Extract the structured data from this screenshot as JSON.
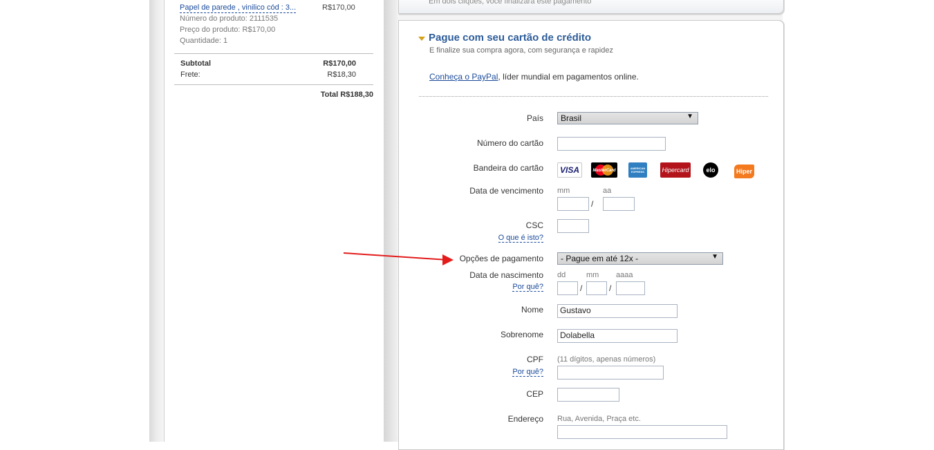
{
  "order": {
    "item_link": "Papel de parede , vinilico cód : 3...",
    "item_price": "R$170,00",
    "product_number": "Número do produto: 2111535",
    "product_price": "Preço do produto: R$170,00",
    "quantity": "Quantidade: 1",
    "subtotal_label": "Subtotal",
    "subtotal_value": "R$170,00",
    "shipping_label": "Frete:",
    "shipping_value": "R$18,30",
    "total": "Total R$188,30"
  },
  "header": {
    "note": "Em dois cliques, você finalizará este pagamento"
  },
  "payment": {
    "title": "Pague com seu cartão de crédito",
    "subtitle": "E finalize sua compra agora, com segurança e rapidez",
    "intro_link": "Conheça o PayPal",
    "intro_rest": ", líder mundial em pagamentos online.",
    "country_label": "País",
    "country_value": "Brasil",
    "card_number_label": "Número do cartão",
    "card_brand_label": "Bandeira do cartão",
    "cards": [
      "VISA",
      "MasterCard",
      "AMERICAN EXPRESS",
      "Hipercard",
      "elo",
      "Hiper"
    ],
    "expiry_label": "Data de vencimento",
    "expiry_mm": "mm",
    "expiry_yy": "aa",
    "slash": "/",
    "csc_label": "CSC",
    "csc_help": "O que é isto?",
    "installments_label": "Opções de pagamento",
    "installments_value": "- Pague em até 12x -",
    "birth_label": "Data de nascimento",
    "birth_help": "Por quê?",
    "birth_dd": "dd",
    "birth_mm": "mm",
    "birth_yyyy": "aaaa",
    "first_name_label": "Nome",
    "first_name_value": "Gustavo",
    "last_name_label": "Sobrenome",
    "last_name_value": "Dolabella",
    "cpf_label": "CPF",
    "cpf_hint": "(11 dígitos, apenas números)",
    "cpf_help": "Por quê?",
    "cep_label": "CEP",
    "address_label": "Endereço",
    "address_hint": "Rua, Avenida, Praça etc."
  },
  "colors": {
    "accent_blue": "#2d5c99",
    "link_blue": "#1a4a9a",
    "arrow_red": "#e31b1b"
  }
}
